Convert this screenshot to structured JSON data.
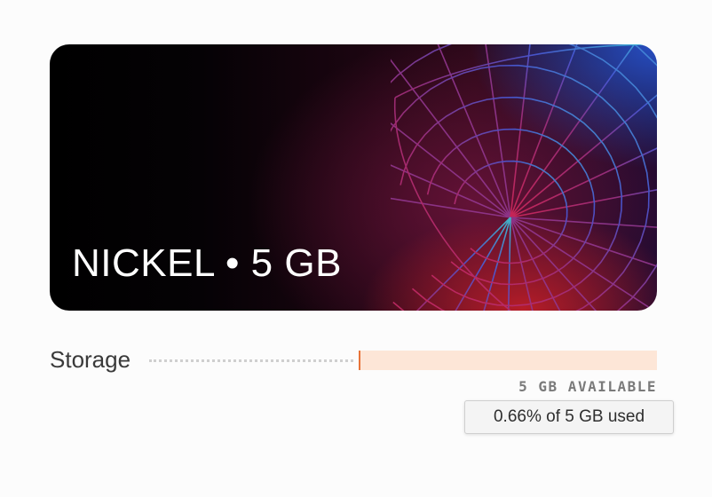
{
  "plan": {
    "title": "NICKEL • 5 GB",
    "art_icon": "wireframe-globe-icon"
  },
  "storage": {
    "label": "Storage",
    "available_text": "5 GB AVAILABLE",
    "used_percent": 0.66,
    "tooltip": "0.66% of 5 GB used",
    "colors": {
      "bar_track": "#fde6d7",
      "bar_fill": "#e8743a"
    }
  }
}
